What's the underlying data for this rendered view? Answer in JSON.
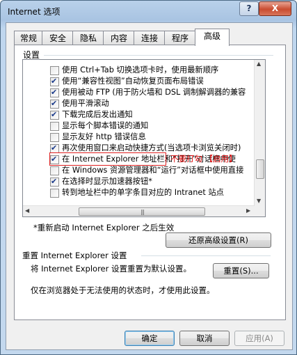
{
  "window": {
    "title": "Internet 选项",
    "help_label": "?",
    "close_label": "X"
  },
  "tabs": [
    {
      "label": "常规"
    },
    {
      "label": "安全"
    },
    {
      "label": "隐私"
    },
    {
      "label": "内容"
    },
    {
      "label": "连接"
    },
    {
      "label": "程序"
    },
    {
      "label": "高级",
      "selected": true
    }
  ],
  "settings": {
    "group_label": "设置",
    "items": [
      {
        "label": "使用 Ctrl+Tab 切换选项卡时，使用最新顺序",
        "checked": false
      },
      {
        "label": "使用“兼容性视图”自动恢复页面布局错误",
        "checked": true
      },
      {
        "label": "使用被动 FTP (用于防火墙和 DSL 调制解调器的兼容",
        "checked": true
      },
      {
        "label": "使用平滑滚动",
        "checked": true
      },
      {
        "label": "下载完成后发出通知",
        "checked": true
      },
      {
        "label": "显示每个脚本错误的通知",
        "checked": false
      },
      {
        "label": "显示友好 http 错误信息",
        "checked": false
      },
      {
        "label": "再次使用窗口来启动快捷方式(当选项卡浏览关闭时)",
        "checked": true
      },
      {
        "label": "在 Internet Explorer 地址栏和“打开”对话框中使",
        "checked": true
      },
      {
        "label": "在 Windows 资源管理器和“运行”对话框中使用直接",
        "checked": false
      },
      {
        "label": "在选择时显示加速器按钮*",
        "checked": true
      },
      {
        "label": "转到地址栏中的单字条目对应的 Intranet 站点",
        "checked": false
      }
    ],
    "annotation": "不要打勾 【启用】",
    "annotation_color": "#e01010",
    "restart_note": "*重新启动 Internet Explorer 之后生效",
    "restore_button": "还原高级设置(R)"
  },
  "reset": {
    "group_label": "重置 Internet Explorer 设置",
    "description": "将 Internet Explorer 设置重置为默认设置。",
    "reset_button": "重置(S)...",
    "note": "仅在浏览器处于无法使用的状态时，才使用此设置。"
  },
  "footer": {
    "ok": "确定",
    "cancel": "取消",
    "apply": "应用(A)"
  }
}
